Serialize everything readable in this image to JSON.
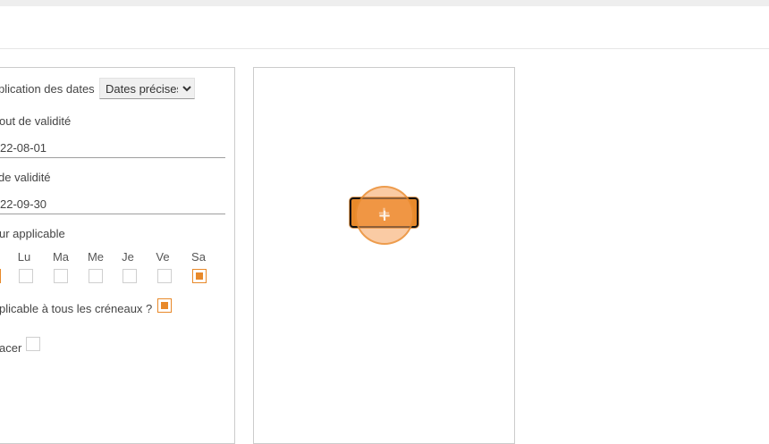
{
  "form": {
    "mode_label": "plication des dates",
    "mode_value": "Dates précises",
    "mode_options": [
      "Dates précises"
    ],
    "start_label": "out de validité",
    "start_value": "22-08-01",
    "end_label": " de validité",
    "end_value": "22-09-30",
    "days_label": "ur applicable",
    "days": [
      {
        "label": "Lu",
        "checked": false
      },
      {
        "label": "Ma",
        "checked": false
      },
      {
        "label": "Me",
        "checked": false
      },
      {
        "label": "Je",
        "checked": false
      },
      {
        "label": "Ve",
        "checked": false
      },
      {
        "label": "Sa",
        "checked": true
      }
    ],
    "all_slots_label": "plicable à tous les créneaux ?",
    "all_slots_checked": true,
    "replace_label": "acer",
    "replace_checked": false
  },
  "slots": {
    "add_button_label": "+",
    "add_button_color": "#e8892a"
  }
}
